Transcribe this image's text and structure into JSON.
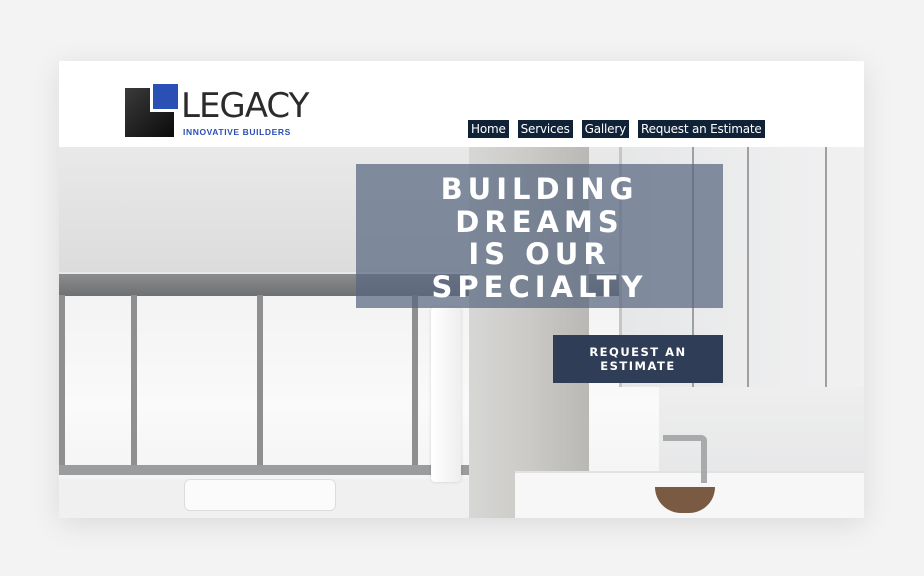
{
  "logo": {
    "word": "LEGACY",
    "tagline": "INNOVATIVE BUILDERS"
  },
  "nav": {
    "items": [
      {
        "label": "Home"
      },
      {
        "label": "Services"
      },
      {
        "label": "Gallery"
      },
      {
        "label": "Request an Estimate"
      }
    ]
  },
  "hero": {
    "title": "BUILDING\nDREAMS\nIS OUR\nSPECIALTY",
    "cta_label": "REQUEST AN ESTIMATE"
  },
  "colors": {
    "nav_bg": "#0f2238",
    "logo_blue": "#2a4fb5",
    "title_box": "#586680",
    "cta_bg": "#2f3d57"
  }
}
